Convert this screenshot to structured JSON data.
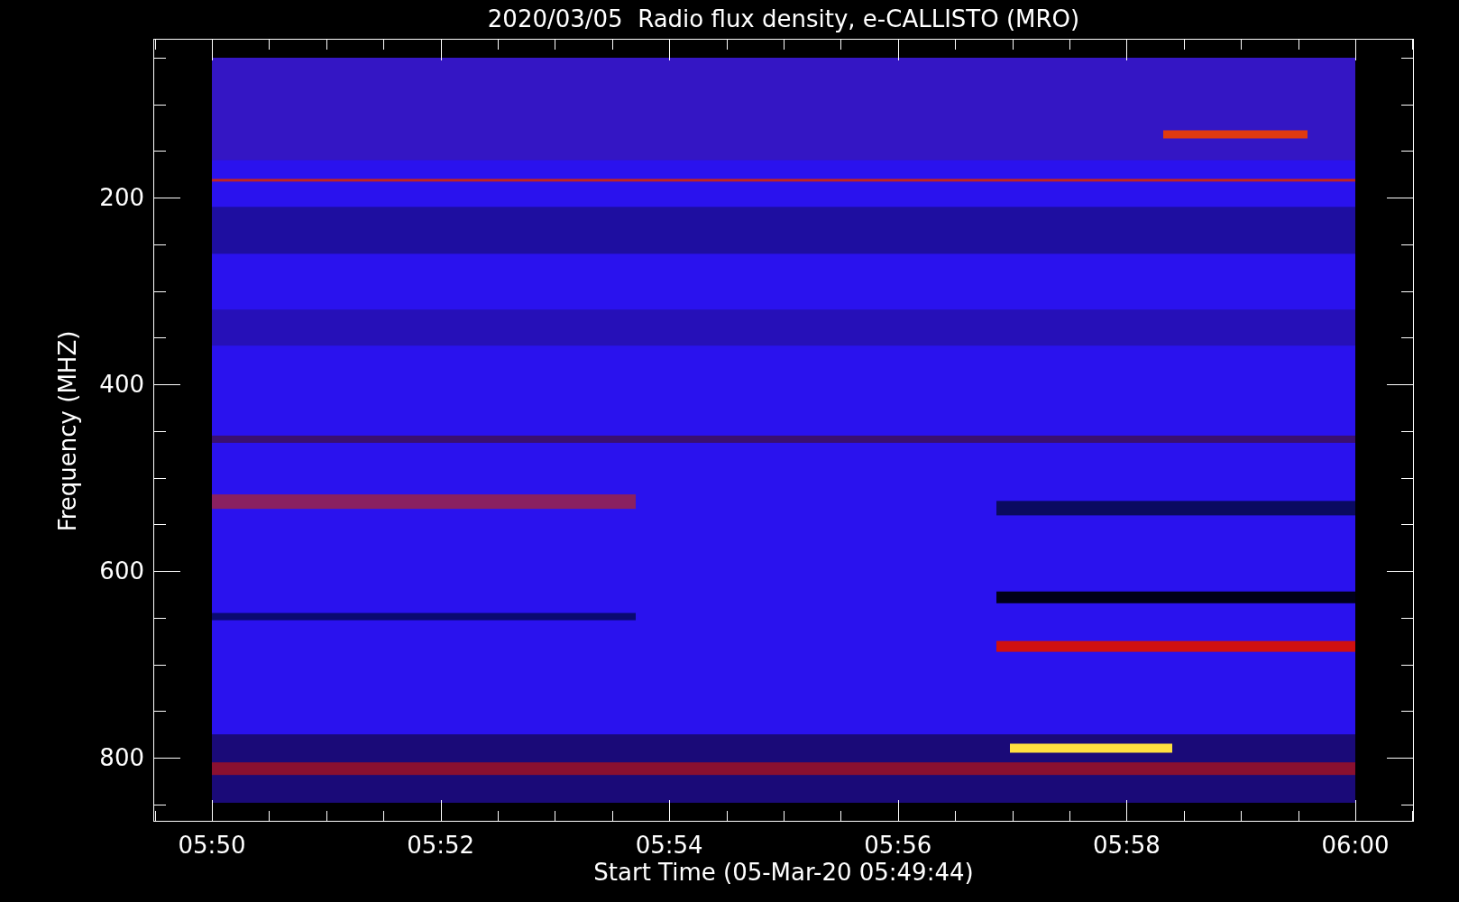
{
  "title": "2020/03/05  Radio flux density, e-CALLISTO (MRO)",
  "x_axis": {
    "label": "Start Time (05-Mar-20 05:49:44)",
    "ticks": [
      "05:50",
      "05:52",
      "05:54",
      "05:56",
      "05:58",
      "06:00"
    ]
  },
  "y_axis": {
    "label": "Frequency (MHZ)",
    "ticks": [
      "200",
      "400",
      "600",
      "800"
    ]
  }
}
